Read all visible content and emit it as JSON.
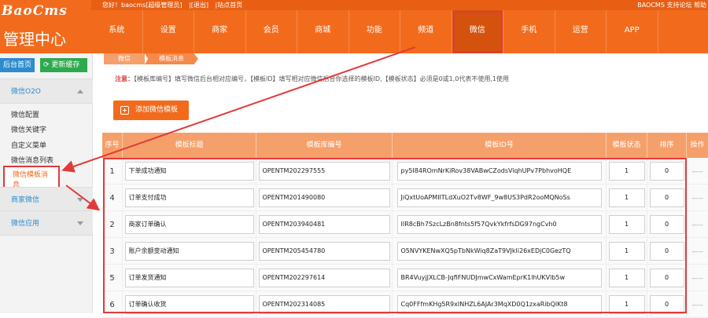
{
  "header": {
    "brand": "BaoCms",
    "title": "管理中心",
    "topbar_links": [
      "您好！baocms[超级管理员]",
      "|[退出]",
      "|站点首页"
    ],
    "topbar_right": "BAOCMS 支持论坛 帮助",
    "nav": [
      "系统",
      "设置",
      "商家",
      "会员",
      "商城",
      "功能",
      "频道",
      "微信",
      "手机",
      "运营",
      "APP"
    ],
    "active_nav": "微信"
  },
  "sidebar": {
    "home_button": "后台首页",
    "cache_button": "更新缓存",
    "group_weixin": "微信O2O",
    "items": [
      "微信配置",
      "微信关键字",
      "自定义菜单",
      "微信消息列表",
      "微信模板消息"
    ],
    "active_item": "微信模板消息",
    "group_merchant": "商家微信",
    "group_app": "微信应用"
  },
  "breadcrumb": [
    "微信",
    "模板消息"
  ],
  "notice": {
    "label": "注意：",
    "text": "【模板库编号】填写微信后台相对应编号，【模板ID】填写相对应微信后台你选择的模板ID,【模板状态】必须是0或1,0代表不使用,1使用"
  },
  "add_button": "添加微信模板",
  "table": {
    "headers": [
      "序号",
      "模板标题",
      "模板库编号",
      "模板ID号",
      "模板状态",
      "排序",
      "操作"
    ],
    "rows": [
      {
        "no": "1",
        "title": "下单成功通知",
        "lib": "OPENTM202297555",
        "tid": "py5I84ROmNrKiRov38VABwCZodsViqhUPv7PbhvoHQE",
        "status": "1",
        "sort": "0",
        "op": "-----"
      },
      {
        "no": "4",
        "title": "订单支付成功",
        "lib": "OPENTM201490080",
        "tid": "JiQxtUoAPMIlTLdXuO2Tv8WF_9w8US3PdR2ooMQNoSs",
        "status": "1",
        "sort": "0",
        "op": "-----"
      },
      {
        "no": "2",
        "title": "商家订单确认",
        "lib": "OPENTM203940481",
        "tid": "IIR8cBh7SzcLzBn8fnts5f57QvkYkfrfsDG97ngCvh0",
        "status": "1",
        "sort": "0",
        "op": "-----"
      },
      {
        "no": "3",
        "title": "账户余额变动通知",
        "lib": "OPENTM205454780",
        "tid": "O5NVYKENwXQ5pTbNkWiq8ZaT9VJkli26xEDjC0GezTQ",
        "status": "1",
        "sort": "0",
        "op": "-----"
      },
      {
        "no": "5",
        "title": "订单发货通知",
        "lib": "OPENTM202297614",
        "tid": "BR4VuyjJXLCB-JqfiFNUDJmwCxWamEprK1lhUKVlb5w",
        "status": "1",
        "sort": "0",
        "op": "-----"
      },
      {
        "no": "6",
        "title": "订单确认收货",
        "lib": "OPENTM202314085",
        "tid": "Cq0FFfmKHg5R9xINHZL6AJAr3MqXD0Q1zxaRibQlKt8",
        "status": "1",
        "sort": "0",
        "op": "-----"
      }
    ]
  },
  "colors": {
    "brand_orange": "#f26b1d",
    "annotation_red": "#e23a3a",
    "link_blue": "#2d8ccf",
    "green": "#2eaa4e"
  }
}
